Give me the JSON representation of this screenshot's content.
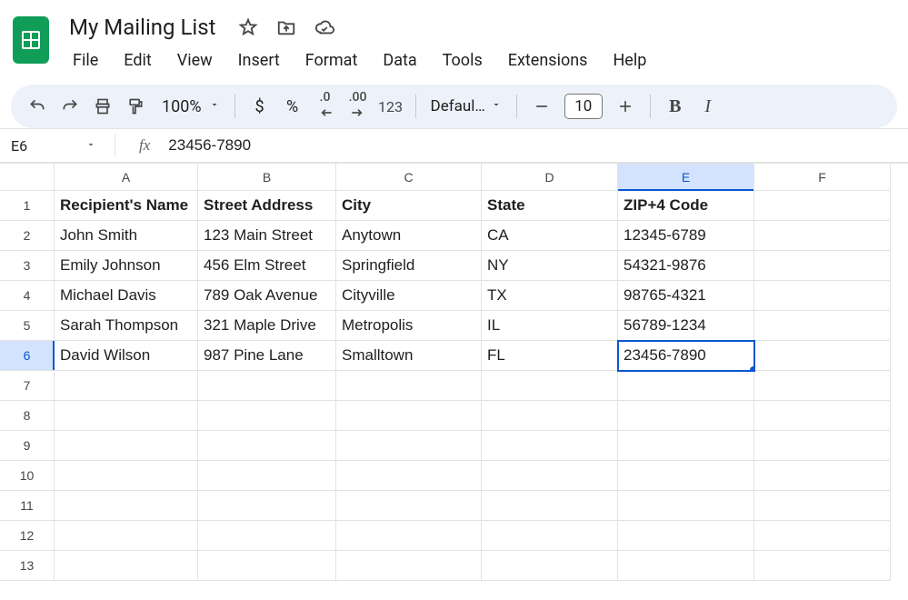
{
  "doc_title": "My Mailing List",
  "menubar": [
    "File",
    "Edit",
    "View",
    "Insert",
    "Format",
    "Data",
    "Tools",
    "Extensions",
    "Help"
  ],
  "toolbar": {
    "zoom": "100%",
    "currency": "$",
    "percent": "%",
    "dec_dec": ".0",
    "dec_inc": ".00",
    "num123": "123",
    "font": "Defaul…",
    "font_size": "10",
    "bold": "B",
    "italic": "I"
  },
  "formula": {
    "cell_ref": "E6",
    "fx": "fx",
    "value": "23456-7890"
  },
  "columns": [
    "A",
    "B",
    "C",
    "D",
    "E",
    "F"
  ],
  "row_numbers": [
    "1",
    "2",
    "3",
    "4",
    "5",
    "6",
    "7",
    "8",
    "9",
    "10",
    "11",
    "12",
    "13"
  ],
  "selected": {
    "col_index": 4,
    "row_index": 5
  },
  "headers": [
    "Recipient's Name",
    "Street Address",
    "City",
    "State",
    "ZIP+4 Code",
    ""
  ],
  "rows": [
    [
      "John Smith",
      "123 Main Street",
      "Anytown",
      "CA",
      "12345-6789",
      ""
    ],
    [
      "Emily Johnson",
      "456 Elm Street",
      "Springfield",
      "NY",
      "54321-9876",
      ""
    ],
    [
      "Michael Davis",
      "789 Oak Avenue",
      "Cityville",
      "TX",
      "98765-4321",
      ""
    ],
    [
      "Sarah Thompson",
      "321 Maple Drive",
      "Metropolis",
      "IL",
      "56789-1234",
      ""
    ],
    [
      "David Wilson",
      "987 Pine Lane",
      "Smalltown",
      "FL",
      "23456-7890",
      ""
    ]
  ],
  "chart_data": {
    "type": "table",
    "columns": [
      "Recipient's Name",
      "Street Address",
      "City",
      "State",
      "ZIP+4 Code"
    ],
    "rows": [
      [
        "John Smith",
        "123 Main Street",
        "Anytown",
        "CA",
        "12345-6789"
      ],
      [
        "Emily Johnson",
        "456 Elm Street",
        "Springfield",
        "NY",
        "54321-9876"
      ],
      [
        "Michael Davis",
        "789 Oak Avenue",
        "Cityville",
        "TX",
        "98765-4321"
      ],
      [
        "Sarah Thompson",
        "321 Maple Drive",
        "Metropolis",
        "IL",
        "56789-1234"
      ],
      [
        "David Wilson",
        "987 Pine Lane",
        "Smalltown",
        "FL",
        "23456-7890"
      ]
    ]
  }
}
